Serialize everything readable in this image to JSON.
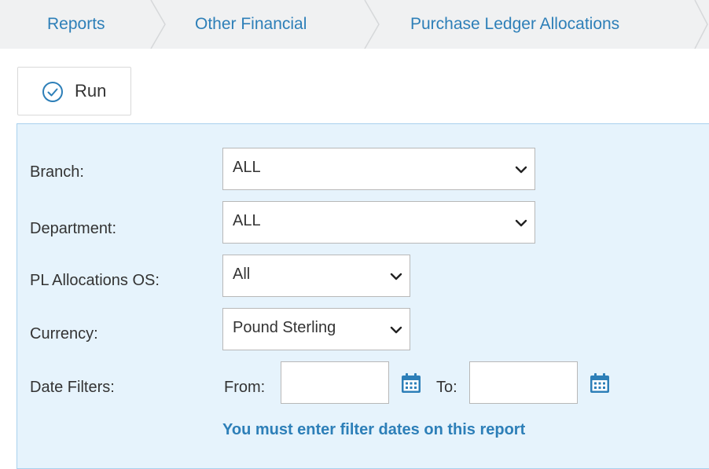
{
  "breadcrumb": {
    "items": [
      {
        "label": "Reports"
      },
      {
        "label": "Other Financial"
      },
      {
        "label": "Purchase Ledger Allocations"
      }
    ]
  },
  "toolbar": {
    "run_label": "Run"
  },
  "filters": {
    "branch": {
      "label": "Branch:",
      "value": "ALL"
    },
    "department": {
      "label": "Department:",
      "value": "ALL"
    },
    "pl_allocations_os": {
      "label": "PL Allocations OS:",
      "value": "All"
    },
    "currency": {
      "label": "Currency:",
      "value": "Pound Sterling"
    },
    "date_filters": {
      "label": "Date Filters:",
      "from_label": "From:",
      "from_value": "",
      "to_label": "To:",
      "to_value": ""
    },
    "message": "You must enter filter dates on this report"
  },
  "colors": {
    "accent": "#2d7fb8",
    "panel_bg": "#e6f3fc",
    "panel_border": "#a9d1ee",
    "breadcrumb_bg": "#f0f1f2"
  },
  "icons": {
    "run": "check-circle-icon",
    "select": "chevron-down-icon",
    "date": "calendar-icon"
  }
}
